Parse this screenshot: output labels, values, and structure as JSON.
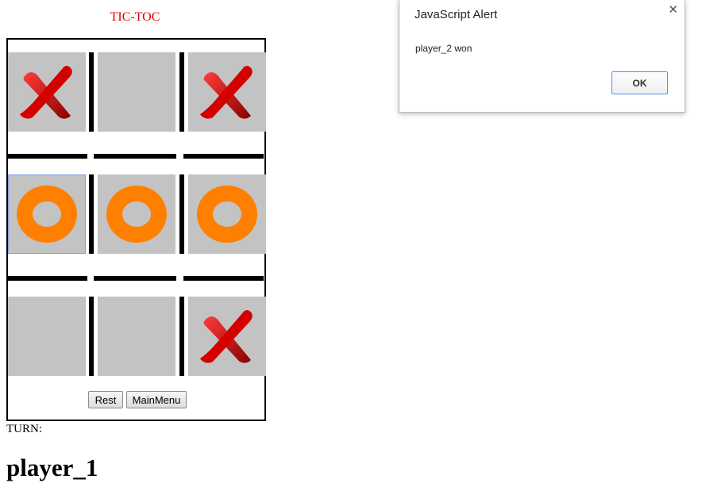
{
  "game": {
    "title": "TIC-TOC",
    "board": [
      {
        "mark": "X",
        "icon": "x-mark-icon"
      },
      {
        "mark": "",
        "icon": ""
      },
      {
        "mark": "X",
        "icon": "x-mark-icon"
      },
      {
        "mark": "O",
        "icon": "o-mark-icon"
      },
      {
        "mark": "O",
        "icon": "o-mark-icon"
      },
      {
        "mark": "O",
        "icon": "o-mark-icon"
      },
      {
        "mark": "",
        "icon": ""
      },
      {
        "mark": "",
        "icon": ""
      },
      {
        "mark": "X",
        "icon": "x-mark-icon"
      }
    ],
    "buttons": {
      "reset_label": "Rest",
      "mainmenu_label": "MainMenu"
    },
    "turn_label": "TURN:",
    "current_player": "player_1",
    "colors": {
      "x": "#d40000",
      "o": "#ff8000",
      "cell": "#c3c3c3",
      "title": "#e00000"
    }
  },
  "alert": {
    "title": "JavaScript Alert",
    "message": "player_2 won",
    "ok_label": "OK",
    "close_icon": "close-icon"
  }
}
